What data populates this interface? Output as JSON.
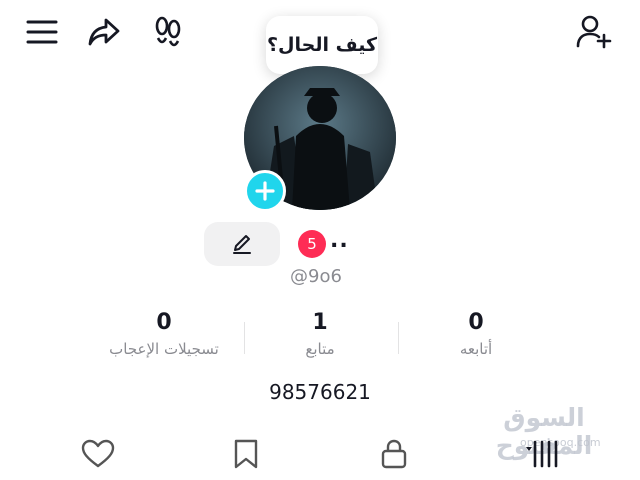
{
  "header": {
    "bubble_text": "كيف الحال؟",
    "icons": [
      "menu-icon",
      "share-icon",
      "footprints-icon",
      "add-user-icon"
    ]
  },
  "profile": {
    "notification_count": "5",
    "display_name": "..",
    "username": "@9o6",
    "phone": "98576621"
  },
  "stats": [
    {
      "key": "followers",
      "value": "0",
      "label": "أتابعه"
    },
    {
      "key": "following",
      "value": "1",
      "label": "متابع"
    },
    {
      "key": "likes",
      "value": "0",
      "label": "تسجيلات الإعجاب"
    }
  ],
  "tabs": [
    "grid-icon",
    "lock-icon",
    "bookmark-icon",
    "heart-icon"
  ],
  "watermark": {
    "text": "السوق المفتوح",
    "sub": "opensooq.com"
  },
  "colors": {
    "accent_cyan": "#20d5ec",
    "badge_red": "#fe2c55",
    "muted_text": "#8a8b91"
  }
}
